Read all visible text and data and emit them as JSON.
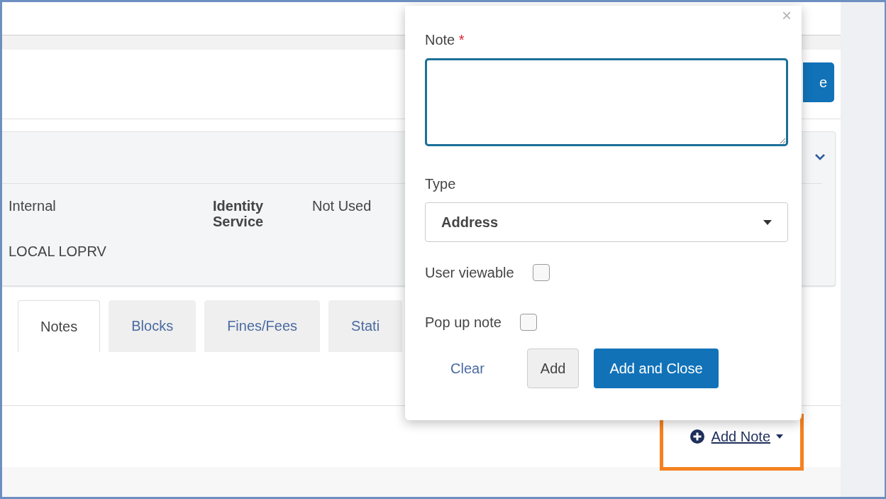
{
  "header_button": {
    "label": "e"
  },
  "details": {
    "value_1": "Internal",
    "label": "Identity Service",
    "value_2": "Not Used",
    "value_3": "LOCAL LOPRV"
  },
  "tabs": [
    {
      "label": "Notes",
      "selected": true
    },
    {
      "label": "Blocks",
      "selected": false
    },
    {
      "label": "Fines/Fees",
      "selected": false
    },
    {
      "label": "Stati",
      "selected": false
    }
  ],
  "add_note": {
    "label": "Add Note",
    "highlighted": true
  },
  "popup": {
    "close": "×",
    "note_label": "Note",
    "required_mark": "*",
    "type_label": "Type",
    "type_value": "Address",
    "checkboxes": [
      {
        "label": "User viewable",
        "checked": false
      },
      {
        "label": "Pop up note",
        "checked": false
      }
    ],
    "clear": "Clear",
    "add": "Add",
    "add_close": "Add and Close"
  }
}
